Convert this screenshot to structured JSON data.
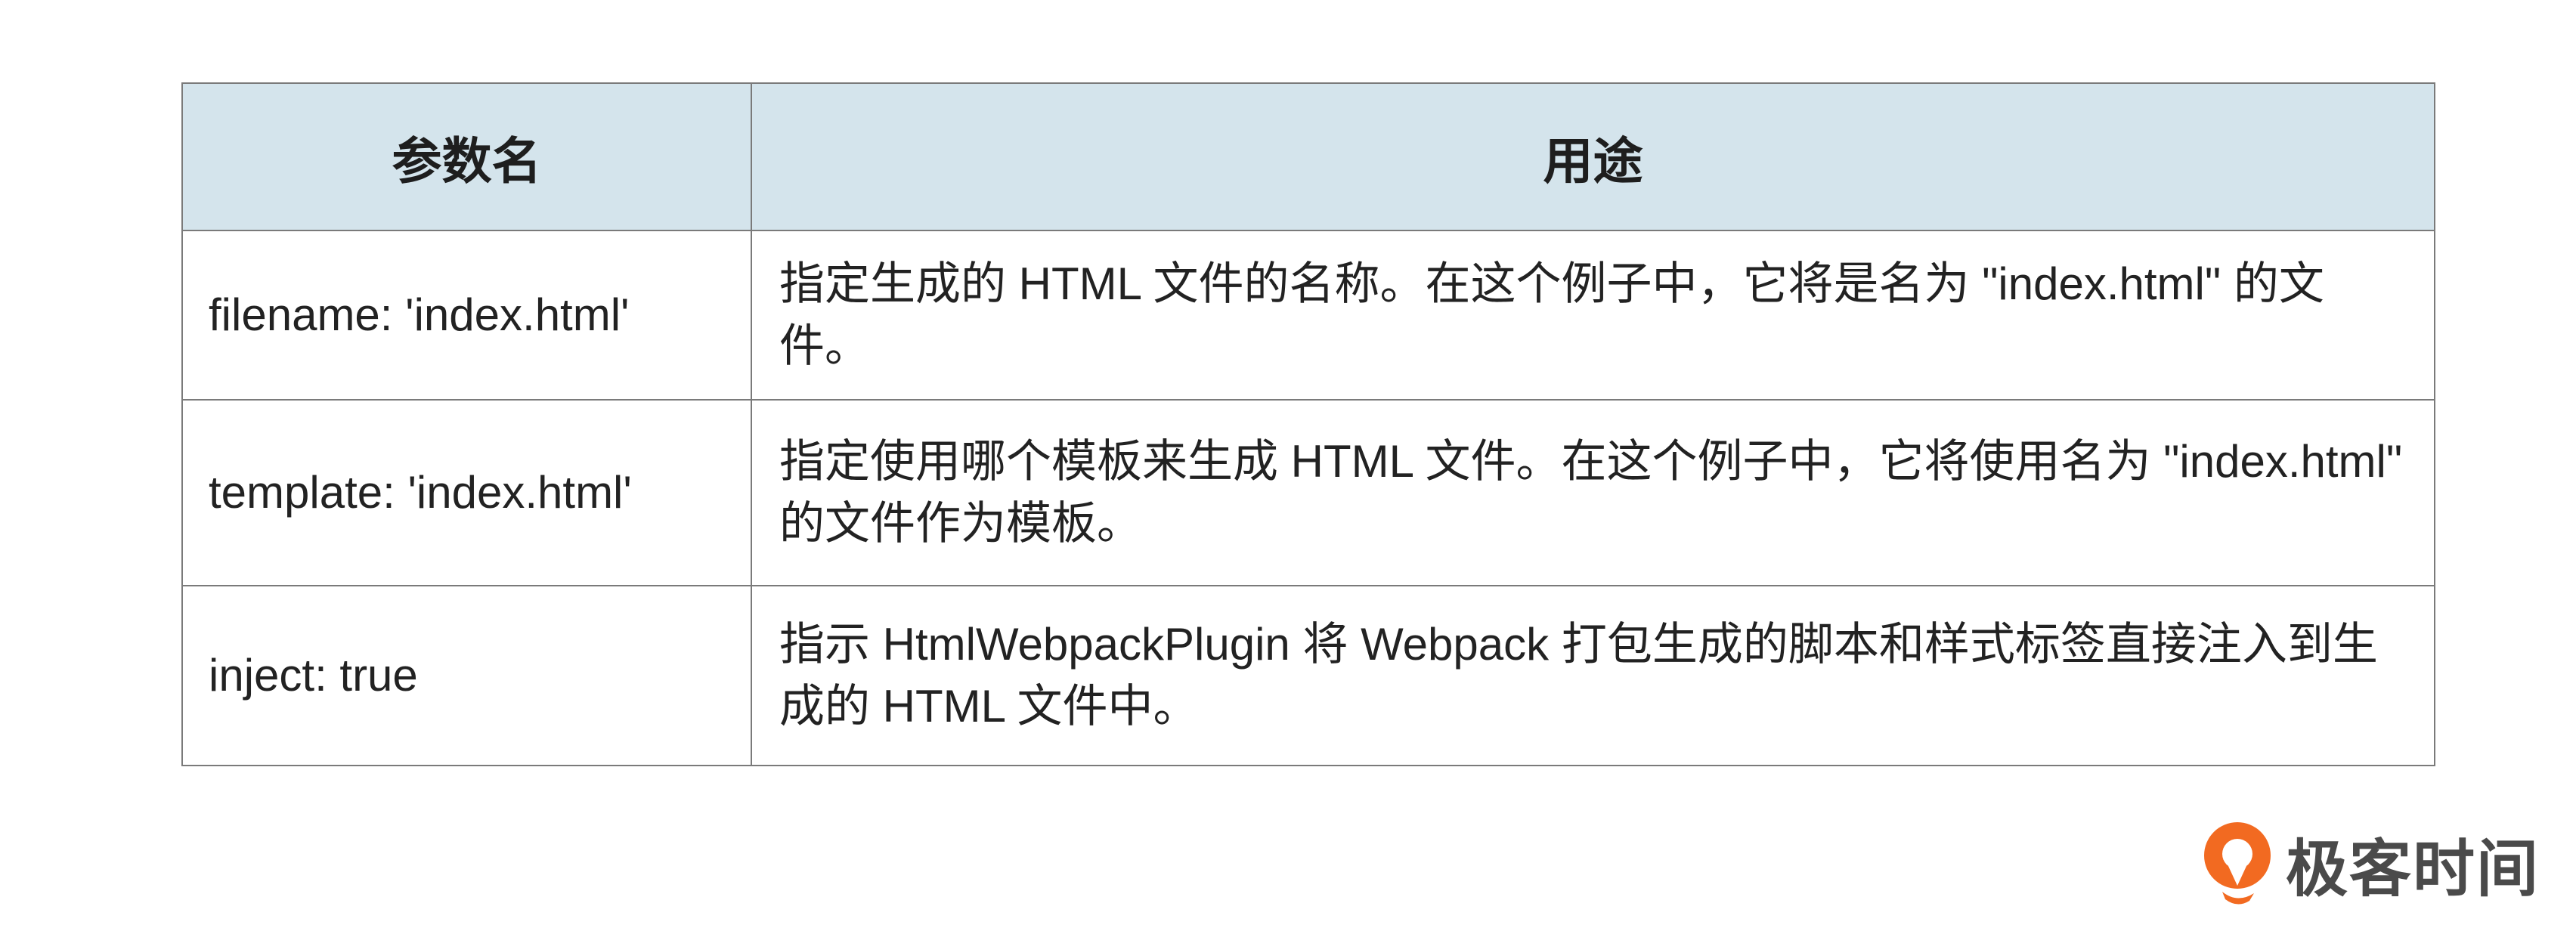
{
  "table": {
    "headers": [
      "参数名",
      "用途"
    ],
    "rows": [
      {
        "name": "filename: 'index.html'",
        "usage": "指定生成的 HTML 文件的名称。在这个例子中，它将是名为 \"index.html\" 的文件。"
      },
      {
        "name": "template: 'index.html'",
        "usage": "指定使用哪个模板来生成 HTML 文件。在这个例子中，它将使用名为 \"index.html\" 的文件作为模板。"
      },
      {
        "name": "inject: true",
        "usage": "指示 HtmlWebpackPlugin 将 Webpack 打包生成的脚本和样式标签直接注入到生成的 HTML 文件中。"
      }
    ]
  },
  "brand": {
    "name": "极客时间",
    "logo_icon": "geektime-logo-icon",
    "logo_color": "#f26a21",
    "header_bg": "#d4e4ec"
  }
}
